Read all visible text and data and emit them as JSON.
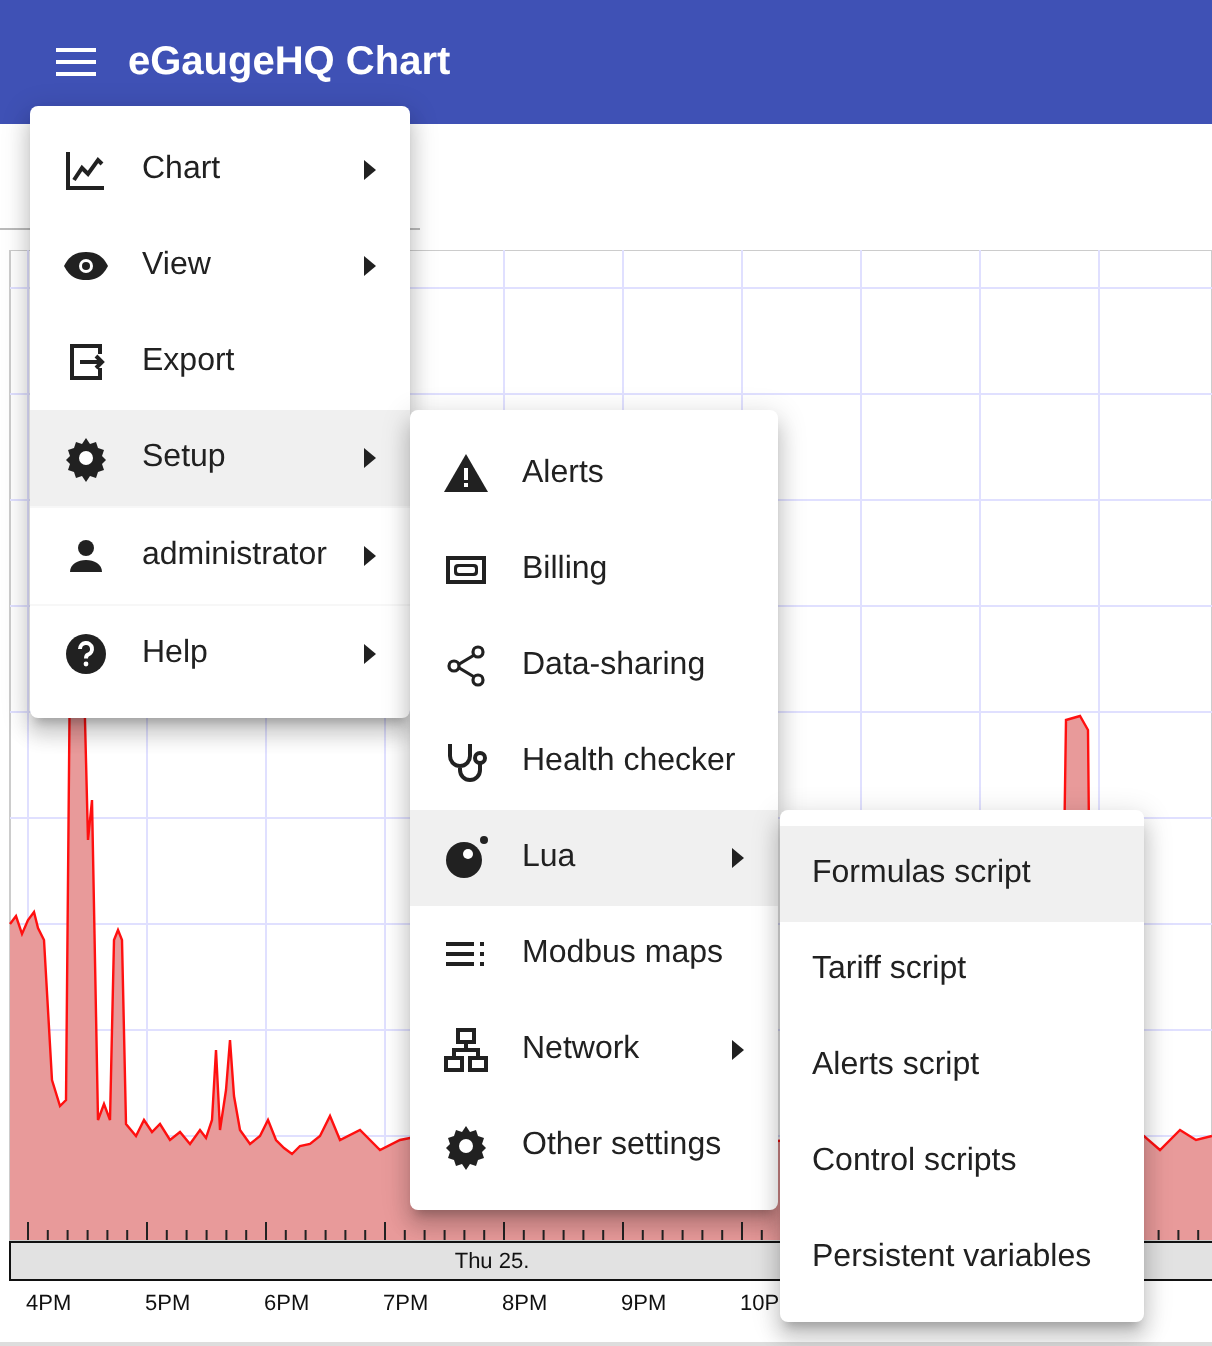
{
  "app_bar": {
    "title": "eGaugeHQ Chart"
  },
  "menu_sections": [
    [
      {
        "label": "Chart",
        "kind": "chart",
        "submenu": true,
        "selected": false
      },
      {
        "label": "View",
        "kind": "eye",
        "submenu": true,
        "selected": false
      },
      {
        "label": "Export",
        "kind": "export",
        "submenu": false,
        "selected": false
      },
      {
        "label": "Setup",
        "kind": "gear",
        "submenu": true,
        "selected": true
      }
    ],
    [
      {
        "label": "administrator",
        "kind": "person",
        "submenu": true,
        "selected": false
      }
    ],
    [
      {
        "label": "Help",
        "kind": "help",
        "submenu": true,
        "selected": false
      }
    ]
  ],
  "setup_menu": [
    {
      "label": "Alerts",
      "kind": "warning",
      "submenu": false,
      "selected": false
    },
    {
      "label": "Billing",
      "kind": "billing",
      "submenu": false,
      "selected": false
    },
    {
      "label": "Data-sharing",
      "kind": "share",
      "submenu": false,
      "selected": false
    },
    {
      "label": "Health checker",
      "kind": "stethoscope",
      "submenu": false,
      "selected": false
    },
    {
      "label": "Lua",
      "kind": "lua",
      "submenu": true,
      "selected": true
    },
    {
      "label": "Modbus maps",
      "kind": "list",
      "submenu": false,
      "selected": false
    },
    {
      "label": "Network",
      "kind": "network",
      "submenu": true,
      "selected": false
    },
    {
      "label": "Other settings",
      "kind": "gear",
      "submenu": false,
      "selected": false
    }
  ],
  "lua_menu": [
    {
      "label": "Formulas script",
      "selected": true
    },
    {
      "label": "Tariff script",
      "selected": false
    },
    {
      "label": "Alerts script",
      "selected": false
    },
    {
      "label": "Control scripts",
      "selected": false
    },
    {
      "label": "Persistent variables",
      "selected": false
    }
  ],
  "time_axis": {
    "date": "Thu 25.",
    "hours": [
      "4PM",
      "5PM",
      "6PM",
      "7PM",
      "8PM",
      "9PM",
      "10P"
    ]
  }
}
